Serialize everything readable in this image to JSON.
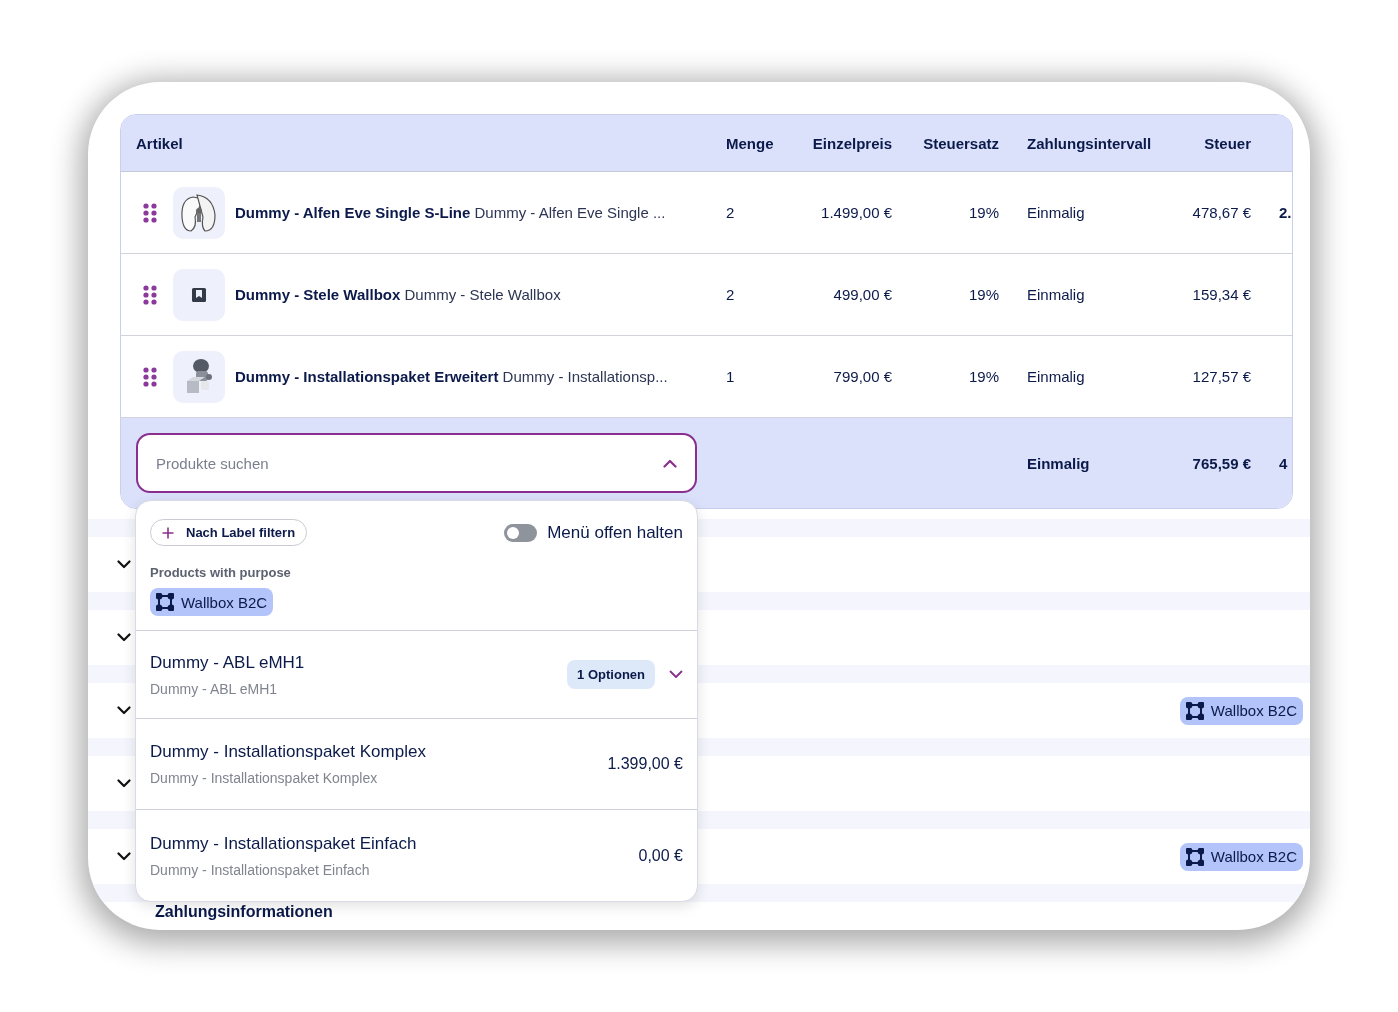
{
  "table": {
    "columns": [
      "Artikel",
      "Menge",
      "Einzelpreis",
      "Steuersatz",
      "Zahlungsintervall",
      "Steuer"
    ],
    "rows": [
      {
        "name": "Dummy - Alfen Eve Single S-Line",
        "description": "Dummy - Alfen Eve Single ...",
        "quantity": "2",
        "unit_price": "1.499,00 €",
        "tax_rate": "19%",
        "interval": "Einmalig",
        "tax": "478,67 €",
        "column_7": "2."
      },
      {
        "name": "Dummy - Stele Wallbox",
        "description": "Dummy - Stele Wallbox",
        "quantity": "2",
        "unit_price": "499,00 €",
        "tax_rate": "19%",
        "interval": "Einmalig",
        "tax": "159,34 €"
      },
      {
        "name": "Dummy - Installationspaket Erweitert",
        "description": "Dummy - Installationsp...",
        "quantity": "1",
        "unit_price": "799,00 €",
        "tax_rate": "19%",
        "interval": "Einmalig",
        "tax": "127,57 €"
      }
    ],
    "footer": {
      "search": {
        "placeholder": "Produkte suchen",
        "expanded": true
      },
      "interval": "Einmalig",
      "tax": "765,59 €",
      "column_7": "4"
    }
  },
  "dropdown": {
    "filter_button": "Nach Label filtern",
    "toggle": {
      "label": "Menü offen halten",
      "on": false
    },
    "group_label": "Products with purpose",
    "purpose_tag": "Wallbox B2C",
    "options": [
      {
        "kind": "variants",
        "name": "Dummy - ABL eMH1",
        "description": "Dummy - ABL eMH1",
        "badge": "1 Optionen"
      },
      {
        "kind": "priced",
        "name": "Dummy - Installationspaket Komplex",
        "description": "Dummy - Installationspaket Komplex",
        "price": "1.399,00 €"
      },
      {
        "kind": "priced",
        "name": "Dummy - Installationspaket Einfach",
        "description": "Dummy - Installationspaket Einfach",
        "price": "0,00 €"
      }
    ]
  },
  "sections": [
    {
      "kind": "plain"
    },
    {
      "kind": "plain"
    },
    {
      "kind": "tagged",
      "tag": "Wallbox B2C"
    },
    {
      "kind": "plain"
    },
    {
      "kind": "tagged",
      "tag": "Wallbox B2C"
    }
  ],
  "payment_heading": "Zahlungsinformationen"
}
